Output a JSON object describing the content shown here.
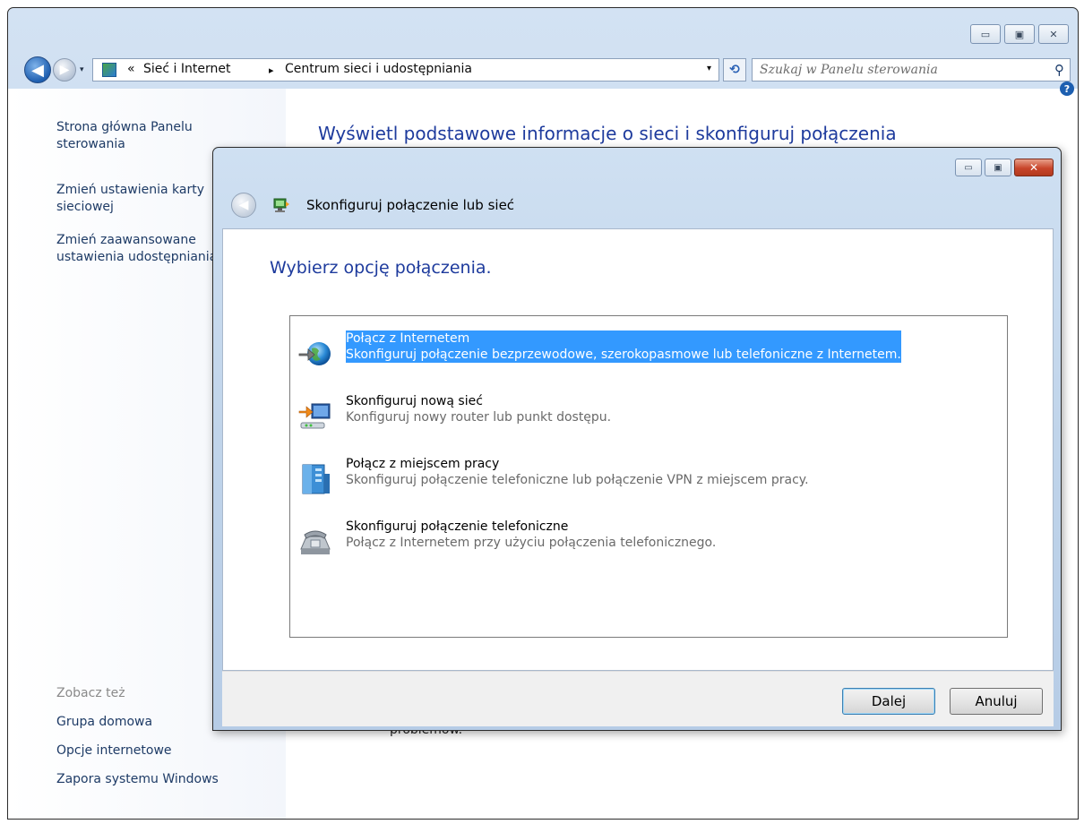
{
  "window": {
    "min_glyph": "▭",
    "max_glyph": "▣",
    "close_glyph": "✕"
  },
  "address_bar": {
    "chevron": "«",
    "breadcrumb": [
      "Sieć i Internet",
      "Centrum sieci i udostępniania"
    ],
    "separator": "▸",
    "dropdown_glyph": "▾"
  },
  "search": {
    "placeholder": "Szukaj w Panelu sterowania"
  },
  "left_pane": {
    "links": [
      "Strona główna Panelu sterowania",
      "Zmień ustawienia karty sieciowej",
      "Zmień zaawansowane ustawienia udostępniania"
    ],
    "see_also_label": "Zobacz też",
    "see_also": [
      "Grupa domowa",
      "Opcje internetowe",
      "Zapora systemu Windows"
    ]
  },
  "main": {
    "title": "Wyświetl podstawowe informacje o sieci i skonfiguruj połączenia",
    "partial_text": "problemów."
  },
  "dialog": {
    "title": "Skonfiguruj połączenie lub sieć",
    "heading": "Wybierz opcję połączenia.",
    "options": [
      {
        "title": "Połącz z Internetem",
        "desc": "Skonfiguruj połączenie bezprzewodowe, szerokopasmowe lub telefoniczne z Internetem.",
        "icon": "globe-icon",
        "selected": true
      },
      {
        "title": "Skonfiguruj nową sieć",
        "desc": "Konfiguruj nowy router lub punkt dostępu.",
        "icon": "router-icon",
        "selected": false
      },
      {
        "title": "Połącz z miejscem pracy",
        "desc": "Skonfiguruj połączenie telefoniczne lub połączenie VPN z miejscem pracy.",
        "icon": "workplace-icon",
        "selected": false
      },
      {
        "title": "Skonfiguruj połączenie telefoniczne",
        "desc": "Połącz z Internetem przy użyciu połączenia telefonicznego.",
        "icon": "telephone-icon",
        "selected": false
      }
    ],
    "buttons": {
      "next": "Dalej",
      "cancel": "Anuluj"
    }
  },
  "colors": {
    "accent": "#1e3b9d",
    "selection": "#3399ff",
    "close_red": "#c8452b"
  }
}
